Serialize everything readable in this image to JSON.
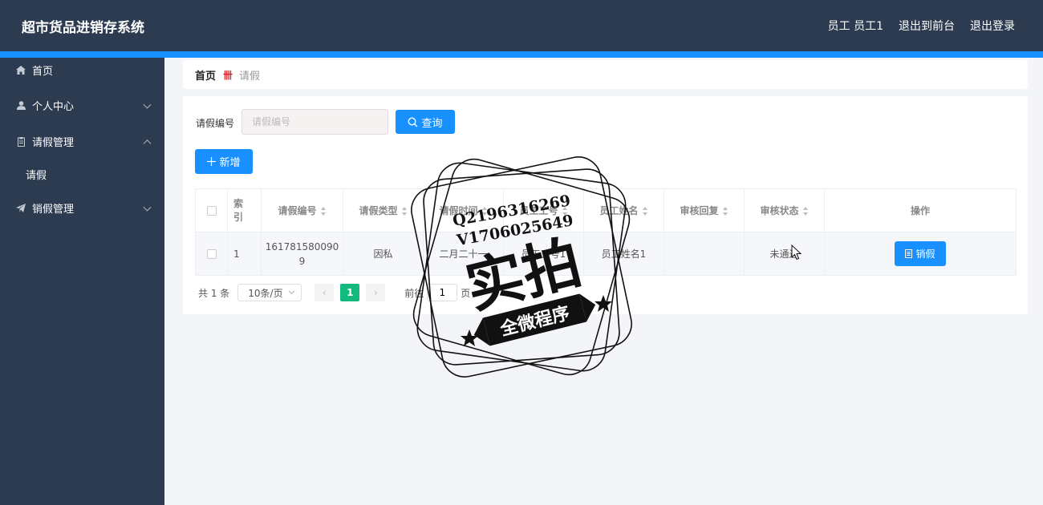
{
  "app": {
    "title": "超市货品进销存系统"
  },
  "header": {
    "user_label": "员工 员工1",
    "front_label": "退出到前台",
    "logout_label": "退出登录"
  },
  "sidebar": {
    "items": [
      {
        "label": "首页",
        "icon": "home-icon"
      },
      {
        "label": "个人中心",
        "icon": "user-icon"
      },
      {
        "label": "请假管理",
        "icon": "clipboard-icon"
      },
      {
        "label": "请假",
        "sub": true
      },
      {
        "label": "销假管理",
        "icon": "paper-plane-icon"
      }
    ]
  },
  "breadcrumb": {
    "home": "首页",
    "current": "请假"
  },
  "search": {
    "label": "请假编号",
    "placeholder": "请假编号",
    "query_label": "查询"
  },
  "toolbar": {
    "add_label": "新增"
  },
  "table": {
    "headers": [
      "索引",
      "请假编号",
      "请假类型",
      "请假时间",
      "员工工号",
      "员工姓名",
      "审核回复",
      "审核状态",
      "操作"
    ],
    "rows": [
      {
        "index": "1",
        "code": "1617815800909",
        "type": "因私",
        "time": "二月二十一",
        "emp_no": "员工工号1",
        "emp_name": "员工姓名1",
        "reply": "",
        "status": "未通过",
        "action_label": "销假"
      }
    ]
  },
  "pagination": {
    "total": "共 1 条",
    "page_size": "10条/页",
    "current_page": "1",
    "goto_prefix": "前往",
    "goto_value": "1",
    "goto_suffix": "页"
  },
  "watermark": {
    "line1": "Q2196316269",
    "line2": "V1706025649",
    "main": "实拍",
    "banner": "全微程序"
  },
  "colors": {
    "header_bg": "#2c3b4f",
    "accent": "#1890ff",
    "page_active": "#14b97e"
  }
}
